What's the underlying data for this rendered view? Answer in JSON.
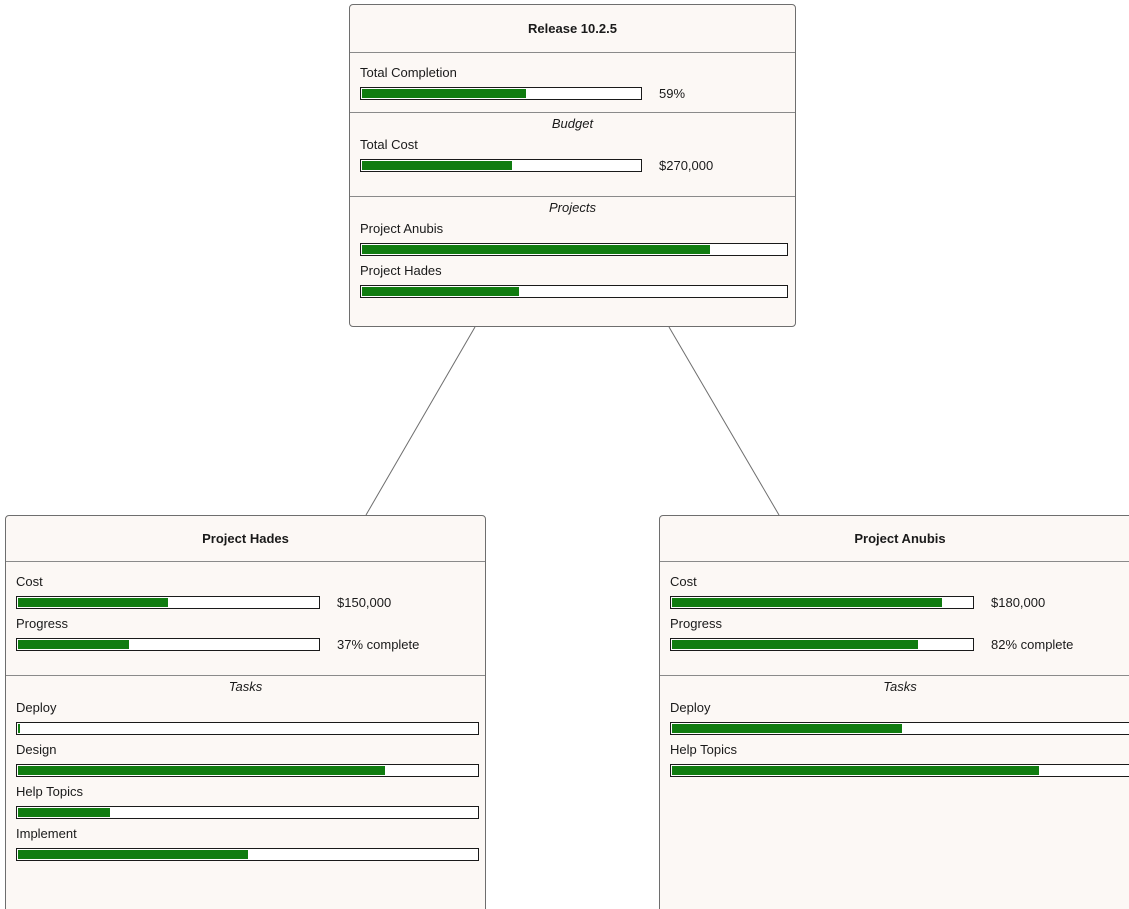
{
  "release": {
    "title": "Release 10.2.5",
    "completion_label": "Total Completion",
    "completion_value": "59%",
    "completion_fraction": 0.59,
    "budget_header": "Budget",
    "cost_label": "Total Cost",
    "cost_value": "$270,000",
    "cost_fraction": 0.54,
    "projects_header": "Projects",
    "projects": [
      {
        "label": "Project Anubis",
        "fraction": 0.82
      },
      {
        "label": "Project Hades",
        "fraction": 0.37
      }
    ]
  },
  "hades": {
    "title": "Project Hades",
    "cost_label": "Cost",
    "cost_value": "$150,000",
    "cost_fraction": 0.5,
    "progress_label": "Progress",
    "progress_value": "37% complete",
    "progress_fraction": 0.37,
    "tasks_header": "Tasks",
    "tasks": [
      {
        "label": "Deploy",
        "fraction": 0.005
      },
      {
        "label": "Design",
        "fraction": 0.8
      },
      {
        "label": "Help Topics",
        "fraction": 0.2
      },
      {
        "label": "Implement",
        "fraction": 0.5
      }
    ]
  },
  "anubis": {
    "title": "Project Anubis",
    "cost_label": "Cost",
    "cost_value": "$180,000",
    "cost_fraction": 0.9,
    "progress_label": "Progress",
    "progress_value": "82% complete",
    "progress_fraction": 0.82,
    "tasks_header": "Tasks",
    "tasks": [
      {
        "label": "Deploy",
        "fraction": 0.5
      },
      {
        "label": "Help Topics",
        "fraction": 0.8
      }
    ]
  },
  "colors": {
    "bar_fill": "#107c10",
    "card_background": "#fcf8f5",
    "border": "#6e6e6e"
  }
}
